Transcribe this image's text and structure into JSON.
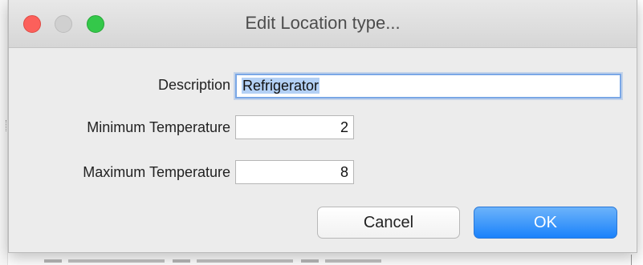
{
  "window": {
    "title": "Edit Location type..."
  },
  "form": {
    "description": {
      "label": "Description",
      "value": "Refrigerator"
    },
    "min_temperature": {
      "label": "Minimum Temperature",
      "value": "2"
    },
    "max_temperature": {
      "label": "Maximum Temperature",
      "value": "8"
    }
  },
  "buttons": {
    "cancel_label": "Cancel",
    "ok_label": "OK"
  },
  "colors": {
    "close": "#fc605b",
    "minimize": "#d0d0d0",
    "zoom": "#34c84a",
    "ok_button": "#1a82fb",
    "focus_ring": "#7aa7e6",
    "selection": "#b3d0f5"
  },
  "icons": {
    "close": "close-icon",
    "minimize": "minimize-icon",
    "zoom": "zoom-icon"
  }
}
